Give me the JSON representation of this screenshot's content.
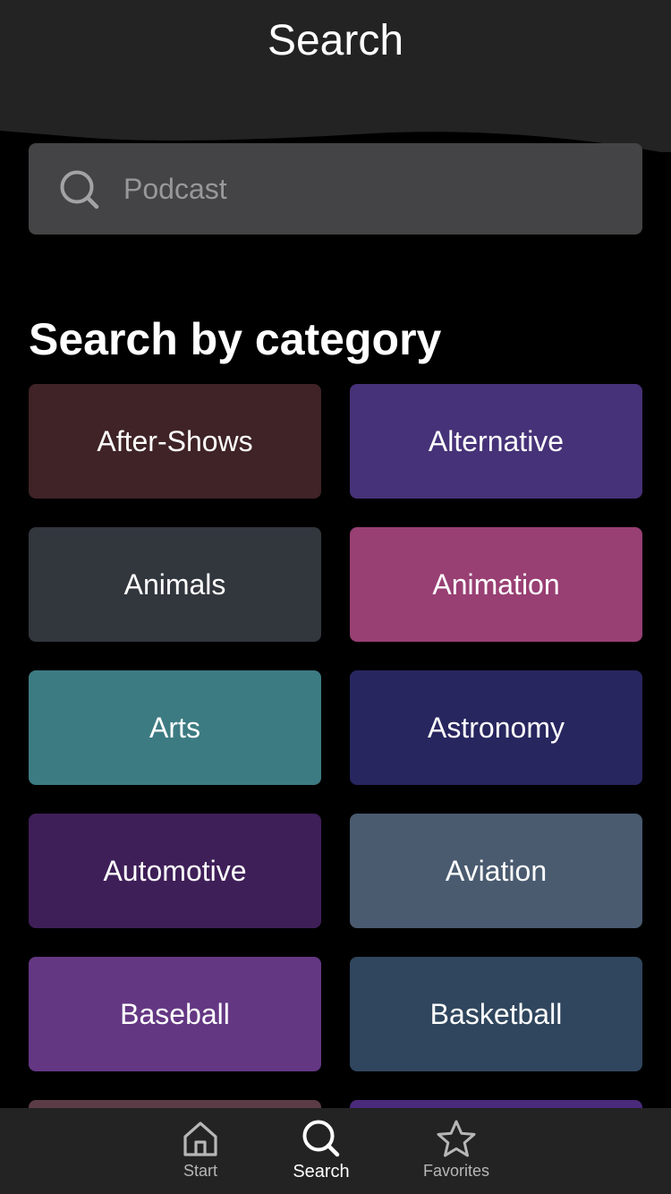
{
  "header": {
    "title": "Search"
  },
  "search": {
    "placeholder": "Podcast"
  },
  "section": {
    "title": "Search by category"
  },
  "categories": [
    {
      "label": "After-Shows",
      "color": "#3f2326"
    },
    {
      "label": "Alternative",
      "color": "#463278"
    },
    {
      "label": "Animals",
      "color": "#32363d"
    },
    {
      "label": "Animation",
      "color": "#983f73"
    },
    {
      "label": "Arts",
      "color": "#3d7b82"
    },
    {
      "label": "Astronomy",
      "color": "#28265f"
    },
    {
      "label": "Automotive",
      "color": "#3f1f58"
    },
    {
      "label": "Aviation",
      "color": "#4a5b70"
    },
    {
      "label": "Baseball",
      "color": "#643783"
    },
    {
      "label": "Basketball",
      "color": "#30465e"
    },
    {
      "label": "",
      "color": "#5b3c46"
    },
    {
      "label": "",
      "color": "#4a2a7a"
    }
  ],
  "tabs": [
    {
      "label": "Start",
      "icon": "home-icon",
      "active": false
    },
    {
      "label": "Search",
      "icon": "search-icon",
      "active": true
    },
    {
      "label": "Favorites",
      "icon": "star-icon",
      "active": false
    }
  ],
  "colors": {
    "background": "#000000",
    "header": "#232323",
    "search_field": "#444446",
    "tabbar": "#232323",
    "tab_active": "#ffffff",
    "tab_inactive": "#b7b7b9"
  }
}
